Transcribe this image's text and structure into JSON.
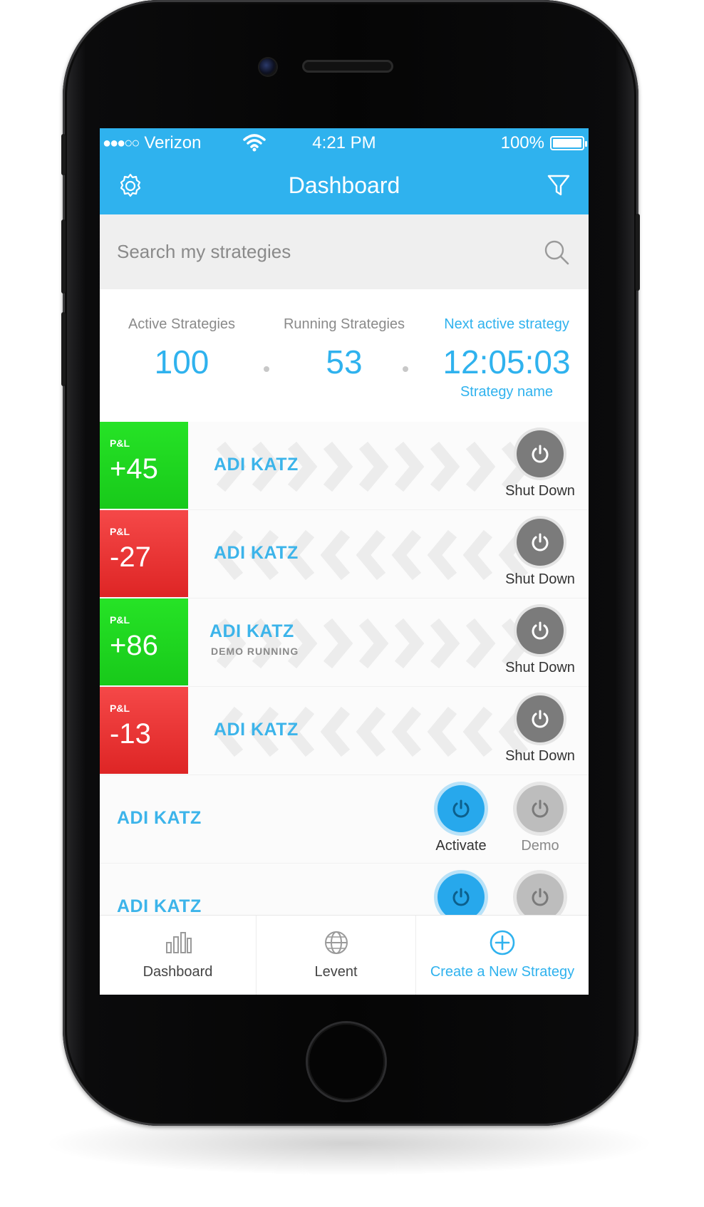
{
  "status_bar": {
    "signal": "●●●○○",
    "carrier": "Verizon",
    "time": "4:21 PM",
    "battery_text": "100%",
    "battery_level": 1.0
  },
  "header": {
    "title": "Dashboard",
    "settings_icon": "gear-icon",
    "filter_icon": "filter-icon"
  },
  "search": {
    "placeholder": "Search my strategies",
    "icon": "search-icon"
  },
  "stats": {
    "active": {
      "label": "Active Strategies",
      "value": "100"
    },
    "running": {
      "label": "Running Strategies",
      "value": "53"
    },
    "next": {
      "label": "Next active strategy",
      "value": "12:05:03",
      "sub": "Strategy name"
    }
  },
  "rows": [
    {
      "pl_label": "P&L",
      "pl_value": "+45",
      "name": "ADI KATZ",
      "action_label": "Shut Down"
    },
    {
      "pl_label": "P&L",
      "pl_value": "-27",
      "name": "ADI KATZ",
      "action_label": "Shut Down"
    },
    {
      "pl_label": "P&L",
      "pl_value": "+86",
      "name": "ADI KATZ",
      "sub": "DEMO RUNNING",
      "action_label": "Shut Down"
    },
    {
      "pl_label": "P&L",
      "pl_value": "-13",
      "name": "ADI KATZ",
      "action_label": "Shut Down"
    },
    {
      "name": "ADI KATZ",
      "activate_label": "Activate",
      "demo_label": "Demo"
    },
    {
      "name": "ADI KATZ"
    }
  ],
  "tabs": [
    {
      "label": "Dashboard",
      "icon": "bar-chart-icon"
    },
    {
      "label": "Levent",
      "icon": "globe-icon"
    },
    {
      "label": "Create a New Strategy",
      "icon": "plus-circle-icon"
    }
  ],
  "colors": {
    "accent": "#2fb2ee",
    "positive": "#1fd621",
    "negative": "#e82e2e"
  }
}
